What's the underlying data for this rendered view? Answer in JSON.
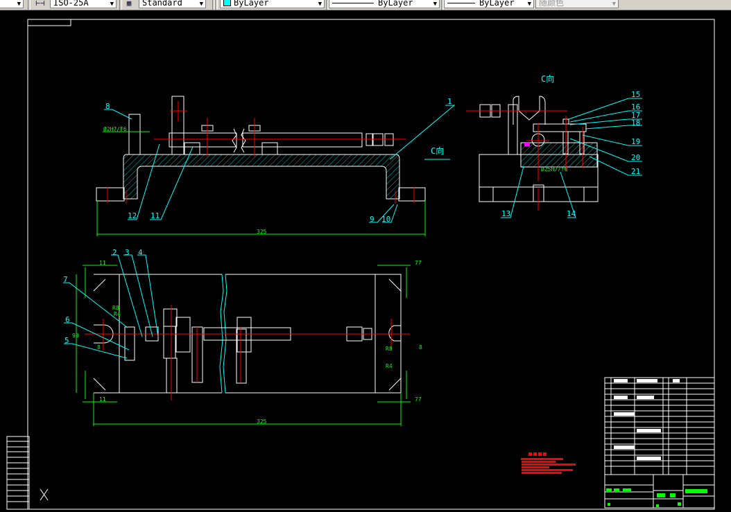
{
  "toolbar": {
    "dimstyle": "ISO-25A",
    "textstyle": "Standard",
    "color": "ByLayer",
    "color_swatch": "#00ffff",
    "linetype": "ByLayer",
    "lineweight": "ByLayer",
    "plotstyle": "随颜色",
    "dimstyle_icon": "dimension-style-icon",
    "textstyle_icon": "table-style-icon"
  },
  "drawing": {
    "view_label": "C向",
    "view_arrow_label": "C向",
    "front_balloons": [
      "1",
      "8",
      "9",
      "10",
      "11",
      "12"
    ],
    "side_balloons": [
      "13",
      "14",
      "15",
      "16",
      "17",
      "18",
      "19",
      "20",
      "21"
    ],
    "top_balloons": [
      "2",
      "3",
      "4",
      "5",
      "6",
      "7"
    ],
    "fit_front": "Ø2H7/F6",
    "fit_side": "Ø25H7/f6",
    "dim_overall_front": "325",
    "dim_overall_top": "325",
    "dim_11": "11",
    "dim_77": "77",
    "dim_8": "8",
    "dim_98": "98",
    "radius_r8": "R8",
    "radius_r4": "R4",
    "colors": {
      "outline": "#ffffff",
      "center": "#ff0000",
      "leader": "#00ffff",
      "dimension": "#00ff00",
      "hatch": "#00ffff"
    }
  }
}
